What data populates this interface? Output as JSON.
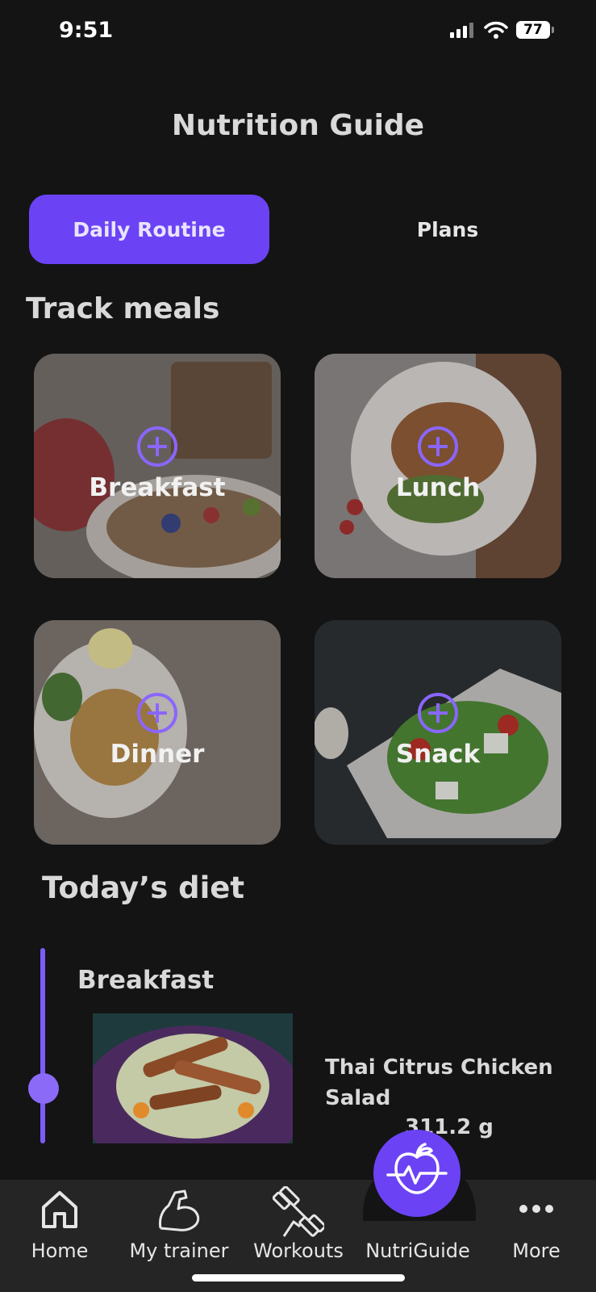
{
  "status_bar": {
    "time": "9:51",
    "battery": "77"
  },
  "page_title": "Nutrition Guide",
  "tabs": [
    {
      "label": "Daily Routine",
      "active": true
    },
    {
      "label": "Plans",
      "active": false
    }
  ],
  "track_meals": {
    "heading": "Track meals",
    "cards": [
      {
        "label": "Breakfast"
      },
      {
        "label": "Lunch"
      },
      {
        "label": "Dinner"
      },
      {
        "label": "Snack"
      }
    ]
  },
  "todays_diet": {
    "heading": "Today’s diet",
    "meal_title": "Breakfast",
    "food_name": "Thai Citrus Chicken Salad",
    "food_weight": "311.2 g"
  },
  "nav": {
    "items": [
      {
        "label": "Home",
        "icon": "home-icon"
      },
      {
        "label": "My trainer",
        "icon": "flexed-arm-icon"
      },
      {
        "label": "Workouts",
        "icon": "dumbbell-icon"
      },
      {
        "label": "NutriGuide",
        "icon": "apple-heartbeat-icon"
      },
      {
        "label": "More",
        "icon": "more-dots-icon"
      }
    ]
  },
  "colors": {
    "accent": "#6b43f5",
    "background": "#141414",
    "nav_background": "#252525"
  }
}
